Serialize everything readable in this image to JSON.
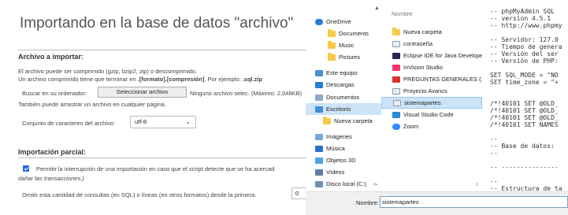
{
  "import_page": {
    "title": "Importando en la base de datos \"archivo\"",
    "file_section": {
      "heading": "Archivo a importar:",
      "line1": "El archivo puede ser comprimido (gzip, bzip2, zip) o descomprimido.",
      "line2_prefix": "Un archivo comprimido tiene que terminar en ",
      "line2_ext": ".[formato].[compresión]",
      "line2_mid": ". Por ejemplo: ",
      "line2_example": ".sql.zip",
      "browse_label": "Buscar en su ordenador:",
      "select_button": "Seleccionar archivo",
      "no_file": "Ninguno archivo selec.  (Máximo: 2,048KB)",
      "drag_hint": "También puede arrastrar un archivo en cualquier página.",
      "charset_label": "Conjunto de caracteres del archivo:",
      "charset_value": "utf-8"
    },
    "partial_section": {
      "heading": "Importación parcial:",
      "checkbox_label": "Permitir la interrupción de una importación en caso que el script detecte que se ha acercad",
      "checkbox_label_cont": "dañar las transacciones.)",
      "skip_label": "Omitir esta cantidad de consultas (en SQL) o líneas (en otros formatos) desde la primera:",
      "skip_value": "0"
    }
  },
  "dialog": {
    "nav": [
      {
        "label": "OneDrive",
        "icon": "cloud-icon"
      },
      {
        "label": "Documents",
        "icon": "folder-icon"
      },
      {
        "label": "Music",
        "icon": "folder-icon"
      },
      {
        "label": "Pictures",
        "icon": "folder-icon"
      },
      {
        "label": "Este equipo",
        "icon": "computer-icon"
      },
      {
        "label": "Descargas",
        "icon": "download-icon"
      },
      {
        "label": "Documentos",
        "icon": "document-folder-icon"
      },
      {
        "label": "Escritorio",
        "icon": "desktop-icon"
      },
      {
        "label": "Nueva carpeta",
        "icon": "folder-icon"
      },
      {
        "label": "Imágenes",
        "icon": "pictures-icon"
      },
      {
        "label": "Música",
        "icon": "music-icon"
      },
      {
        "label": "Objetos 3D",
        "icon": "cube-icon"
      },
      {
        "label": "Vídeos",
        "icon": "video-icon"
      },
      {
        "label": "Disco local (C:)",
        "icon": "drive-icon"
      }
    ],
    "selected_nav_index": 7,
    "files_header": "Nombre",
    "files": [
      {
        "label": "Nueva carpeta",
        "icon": "folder-icon"
      },
      {
        "label": "contraseña",
        "icon": "file-icon"
      },
      {
        "label": "Eclipse IDE for Java Developers",
        "icon": "eclipse-icon"
      },
      {
        "label": "InVision Studio",
        "icon": "invision-icon"
      },
      {
        "label": "PREGUNTAS GENERALES (1)",
        "icon": "pdf-icon"
      },
      {
        "label": "Proyecto Avancs",
        "icon": "file-icon"
      },
      {
        "label": "sistemapartes",
        "icon": "sql-file-icon"
      },
      {
        "label": "Visual Studio Code",
        "icon": "vscode-icon"
      },
      {
        "label": "Zoom",
        "icon": "zoom-icon"
      }
    ],
    "selected_file_index": 6,
    "preview_text": "-- phpMyAdmin SQL\n-- version 4.5.1\n-- http://www.phpmy\n\n-- Servidor: 127.0\n-- Tiempo de genera\n-- Versión del ser\n-- Versión de PHP:\n\nSET SQL_MODE = \"NO\nSET time_zone = \"+\n\n\n/*!40101 SET @OLD_\n/*!40101 SET @OLD_\n/*!40101 SET @OLD_\n/*!40101 SET NAMES\n\n--\n-- Base de datos:\n--\n\n-- ---------------\n\n--\n-- Estructura de ta",
    "filename_label": "Nombre:",
    "filename_value": "sistemapartes"
  },
  "colors": {
    "selection": "#cce4f7",
    "checkbox": "#1e6fd9",
    "folder": "#f7c948"
  }
}
